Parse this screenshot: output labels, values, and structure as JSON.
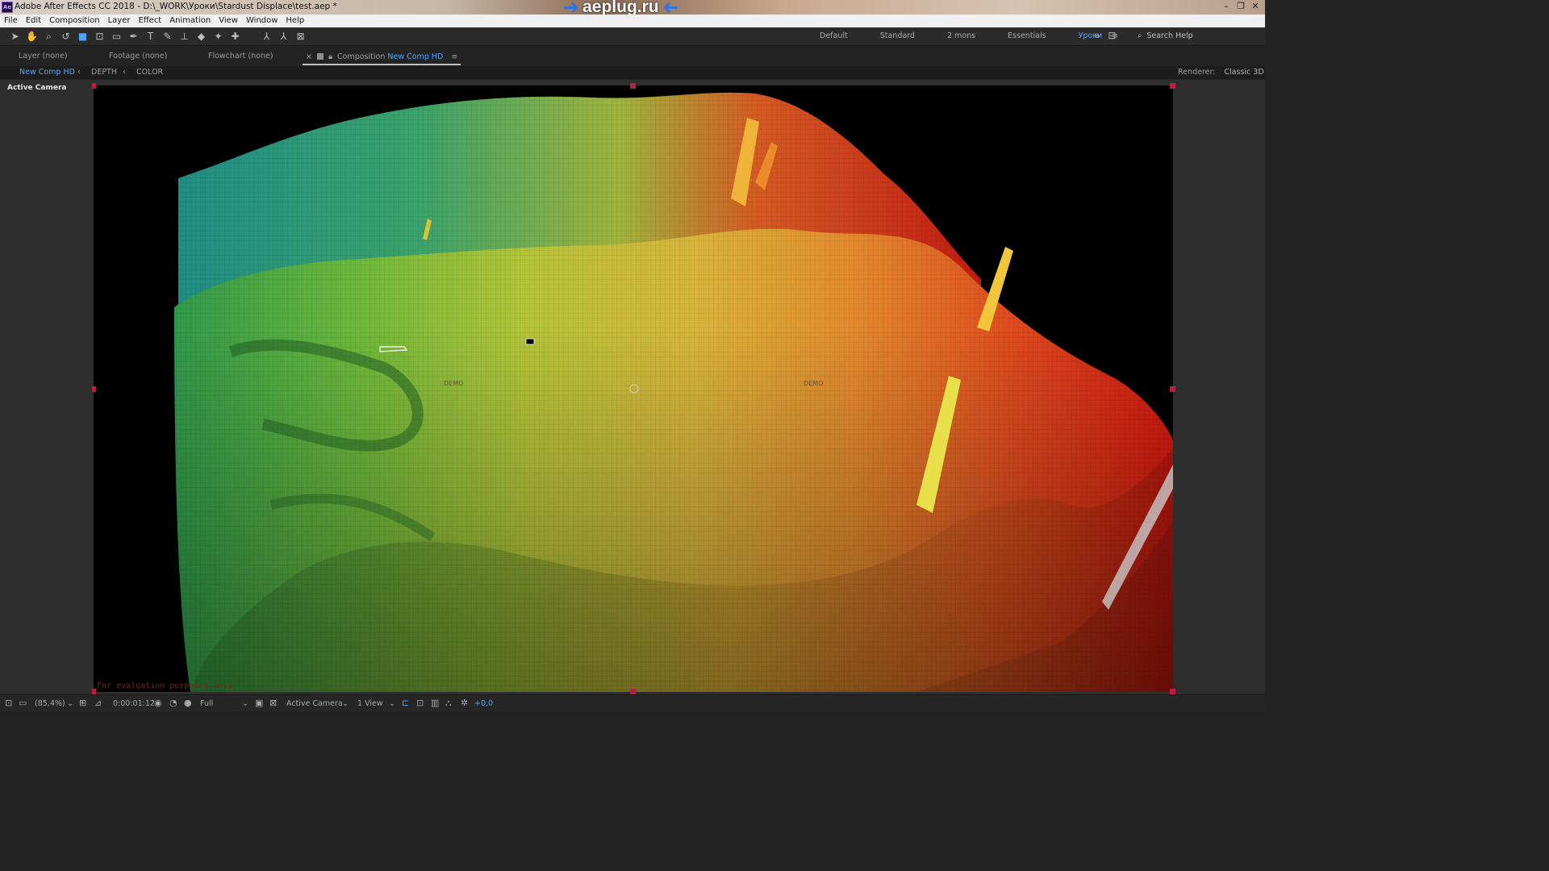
{
  "titlebar": {
    "app_icon": "Ae",
    "title": "Adobe After Effects CC 2018 - D:\\_WORK\\Уроки\\Stardust Displace\\test.aep *",
    "brand": "aeplug.ru",
    "controls": [
      "–",
      "❐",
      "✕"
    ]
  },
  "menu": [
    "File",
    "Edit",
    "Composition",
    "Layer",
    "Effect",
    "Animation",
    "View",
    "Window",
    "Help"
  ],
  "tools": [
    "selection-tool",
    "hand-tool",
    "zoom-tool",
    "orbit-camera-tool",
    "pan-camera-tool",
    "pan-behind-tool",
    "rectangle-tool",
    "pen-tool",
    "type-tool",
    "brush-tool",
    "clone-stamp-tool",
    "eraser-tool",
    "roto-brush-tool",
    "puppet-pin-tool",
    "local-axis-icon",
    "world-axis-icon",
    "view-axis-icon"
  ],
  "workspaces": {
    "items": [
      "Default",
      "Standard",
      "2 mons",
      "Essentials"
    ],
    "active": "Уроки",
    "search_label": "Search Help"
  },
  "panels": {
    "layer": "Layer (none)",
    "footage": "Footage (none)",
    "flowchart": "Flowchart (none)",
    "composition_prefix": "Composition",
    "composition_name": "New Comp HD"
  },
  "breadcrumbs": [
    "New Comp HD",
    "DEPTH",
    "COLOR"
  ],
  "renderer": {
    "label": "Renderer:",
    "value": "Classic 3D"
  },
  "viewer": {
    "camera_label": "Active Camera",
    "watermark": "For evaluation purposes only",
    "demo_labels": [
      "DEMO",
      "DEMO"
    ]
  },
  "status": {
    "zoom": "(85,4%)",
    "timecode": "0:00:01:12",
    "resolution": "Full",
    "camera": "Active Camera",
    "views": "1 View",
    "exposure": "+0,0"
  },
  "colors": {
    "accent": "#4fa5ff",
    "handle": "#b81f45",
    "background": "#232323"
  }
}
